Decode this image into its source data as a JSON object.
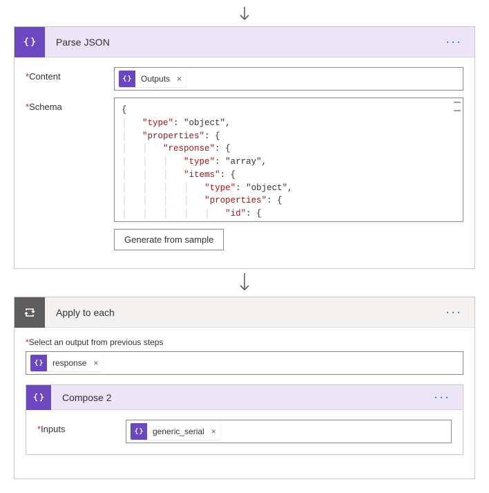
{
  "parseJson": {
    "title": "Parse JSON",
    "contentLabel": "Content",
    "schemaLabel": "Schema",
    "outputsToken": "Outputs",
    "generateButton": "Generate from sample",
    "schemaText": "{\n    \"type\": \"object\",\n    \"properties\": {\n        \"response\": {\n            \"type\": \"array\",\n            \"items\": {\n                \"type\": \"object\",\n                \"properties\": {\n                    \"id\": {\n                        \"type\": \"integer\""
  },
  "applyToEach": {
    "title": "Apply to each",
    "selectLabel": "Select an output from previous steps",
    "responseToken": "response"
  },
  "compose": {
    "title": "Compose 2",
    "inputsLabel": "Inputs",
    "genericSerialToken": "generic_serial"
  }
}
